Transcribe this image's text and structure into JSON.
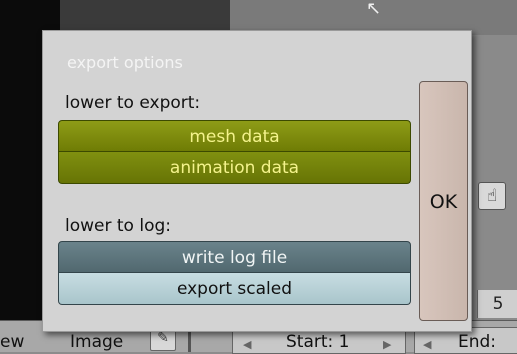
{
  "background": {
    "bottom_bar": {
      "view_label": "ew",
      "image_label": "Image",
      "start_label": "Start: 1",
      "end_label": "End:"
    },
    "frame_number": "5"
  },
  "popup": {
    "title": "export options",
    "export_label": "lower to export:",
    "mesh_button": "mesh data",
    "animation_button": "animation data",
    "log_label": "lower to log:",
    "write_log_button": "write log file",
    "export_scaled_button": "export scaled",
    "ok_button": "OK"
  },
  "colors": {
    "toggle_on": "#7a8a0c",
    "toggle_log": "#5e767d",
    "toggle_scaled": "#b8d0d6",
    "ok_button": "#d0bdb3"
  }
}
